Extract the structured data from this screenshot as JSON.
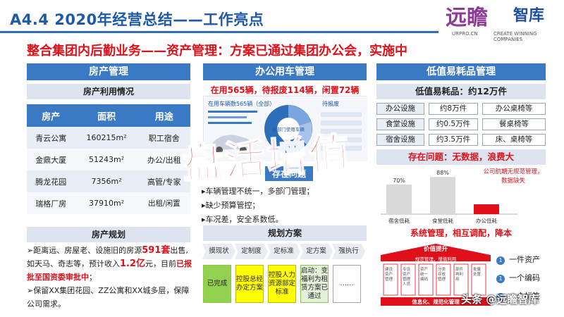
{
  "header": {
    "title": "A4.4  2020年经营总结——工作亮点",
    "logo_main": "远瞻",
    "logo_sub": "智库",
    "logo_url": "URPRO.CN",
    "logo_slogan": "CREATE WINNING COMPANIES"
  },
  "main_title": "整合集团内后勤业务——资产管理：方案已通过集团办公会，实施中",
  "property": {
    "head": "房产管理",
    "usage_head": "房产利用情况",
    "columns": [
      "房产",
      "面积",
      "用途"
    ],
    "rows": [
      [
        "青云公寓",
        "160215m²",
        "职工宿舍"
      ],
      [
        "金鼎大厦",
        "51243m²",
        "办公/出租"
      ],
      [
        "腾龙花园",
        "7356m²",
        "高管/专家"
      ],
      [
        "瑞格厂房",
        "37910m²",
        "出租/闲置"
      ]
    ],
    "plan_head": "房产规划",
    "plan_1a": "距离远、房屋老、设施旧的房源",
    "plan_1_num": "591套",
    "plan_1b": "出售,如天马、奇志等，预计收入",
    "plan_1_amt": "1.2亿",
    "plan_1c": "元，目前",
    "plan_1_status": "已报批至国资委审批中",
    "plan_1d": "；",
    "plan_2": "保留XX集团花园、ZZ公寓和XX城多层，保障公司需求。"
  },
  "vehicle": {
    "head": "办公用车管理",
    "stat": "在用565辆，待报废114辆，闲置72辆",
    "img_title": "在用车辆数565辆（全部）",
    "img_center": "按部门使用车辆",
    "img_right": "待报废",
    "problem_tag": "存在问题",
    "problems": [
      "▸车辆管理不统一，多部门管理；",
      "▸缺少预算管控；",
      "▸车况差，安全系数低。"
    ],
    "plan_head": "规划方案",
    "steps": [
      "摸现状",
      "定制度",
      "定标准",
      "定方案",
      "强执行"
    ],
    "boxes": [
      "已完成",
      "控股总经办定方案",
      "控股人力资源部定标准",
      "启动：变福利为租赁方案已通过",
      "……"
    ]
  },
  "consumables": {
    "head": "低值易耗品管理",
    "stat": "低值易耗品：约12万件",
    "rows": [
      [
        "办公设施",
        "约8万件",
        "办公桌椅等"
      ],
      [
        "食堂设施",
        "约0.5万件",
        "餐桌椅等"
      ],
      [
        "宿舍设施",
        "约3.5万件",
        "床、桌椅等"
      ]
    ],
    "problem": "存在问题：无数据，浪费大",
    "chart_note": "公司航期无规范管理，数据缺失",
    "system": "系统管理，相互调配，降本",
    "value_title": "价值提升",
    "value_sub": "规范管理，增值利用",
    "value_base": "信息化、规范化管理",
    "value_cols": [
      "建设资产管理",
      "专设资产管理人员",
      "资产统一编码",
      "分类存放管理",
      "部件再利用",
      "批量处置"
    ],
    "bullets": [
      "一件资产",
      "一个编码",
      "一个标签"
    ]
  },
  "chart_data": {
    "type": "bar",
    "categories": [
      "宿舍低耗",
      "食堂低耗",
      "办公低耗"
    ],
    "values": [
      70,
      88,
      null
    ],
    "value_labels": [
      "70%",
      "88%",
      ""
    ],
    "colors": [
      "#d9d9d9",
      "#d9d9d9",
      "#e0101a"
    ],
    "title": "",
    "ylim": [
      0,
      100
    ]
  },
  "watermarks": {
    "big": "盘活增值",
    "toutiao": "头条 @远瞻智库"
  }
}
